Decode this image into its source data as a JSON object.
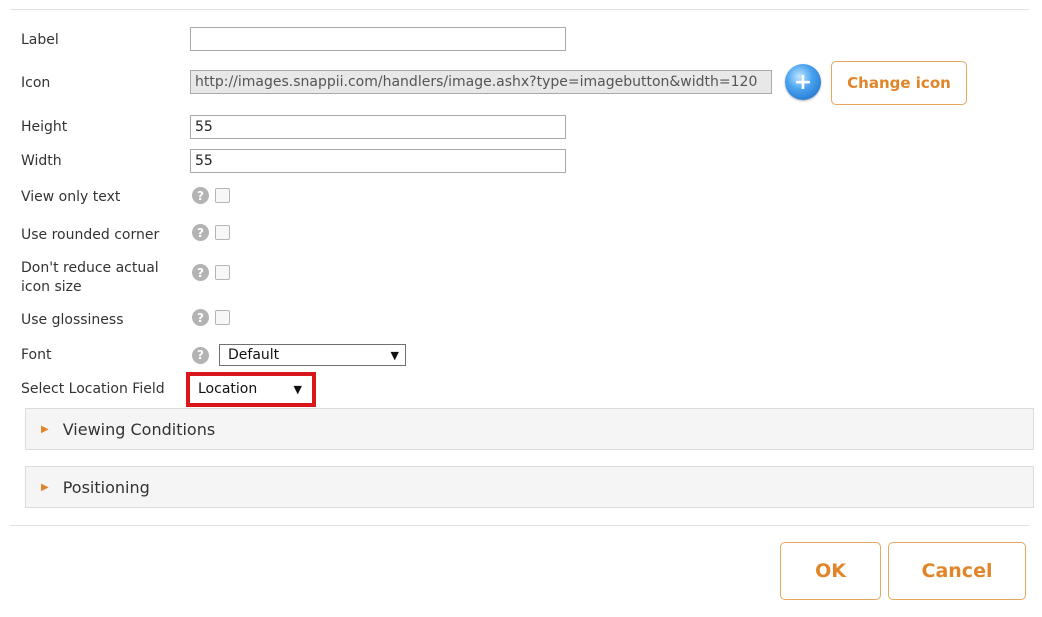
{
  "form": {
    "label": {
      "label": "Label",
      "value": ""
    },
    "icon": {
      "label": "Icon",
      "value": "http://images.snappii.com/handlers/image.ashx?type=imagebutton&width=120",
      "change_button": "Change icon",
      "icon_name": "globe-plus-icon"
    },
    "height": {
      "label": "Height",
      "value": "55"
    },
    "width": {
      "label": "Width",
      "value": "55"
    },
    "view_only_text": {
      "label": "View only text",
      "checked": false
    },
    "use_rounded_corner": {
      "label": "Use rounded corner",
      "checked": false
    },
    "dont_reduce": {
      "label_line1": "Don't reduce actual",
      "label_line2": "icon size",
      "checked": false
    },
    "use_glossiness": {
      "label": "Use glossiness",
      "checked": false
    },
    "font": {
      "label": "Font",
      "selected": "Default"
    },
    "location_field": {
      "label": "Select Location Field",
      "selected": "Location"
    }
  },
  "sections": [
    {
      "label": "Viewing Conditions"
    },
    {
      "label": "Positioning"
    }
  ],
  "help_glyph": "?",
  "arrow_glyph": "▼",
  "tri_glyph": "▶",
  "footer": {
    "ok_label": "OK",
    "cancel_label": "Cancel"
  },
  "colors": {
    "accent": "#e1852a",
    "highlight": "#d9161c"
  }
}
